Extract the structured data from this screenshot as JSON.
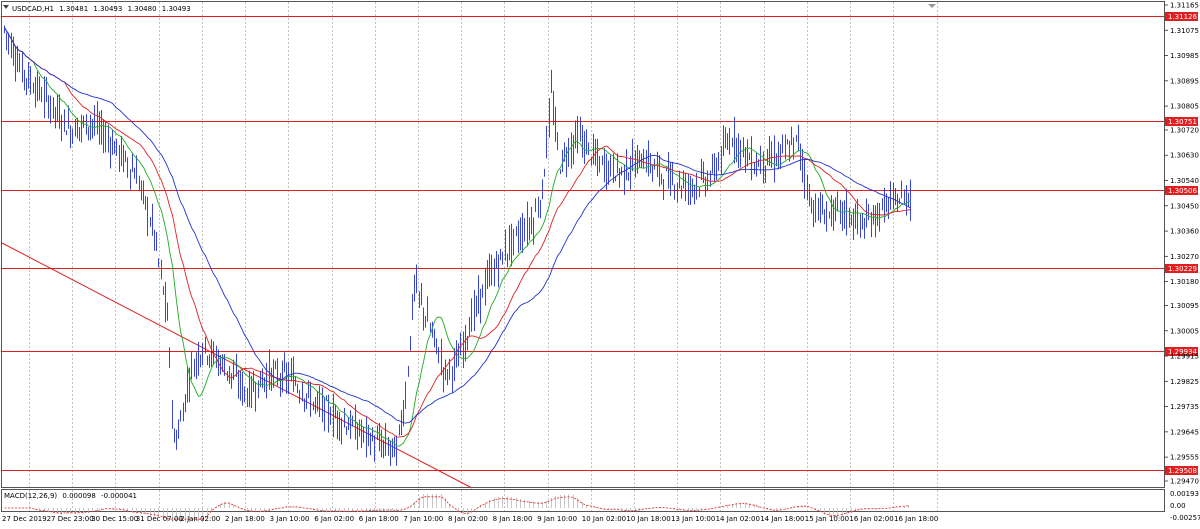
{
  "chart_title": "USDCAD,H1",
  "ohlc": {
    "open": "1.30481",
    "high": "1.30493",
    "low": "1.30480",
    "close": "1.30493"
  },
  "macd_label": "MACD(12,26,9)",
  "macd_values": {
    "main": "0.000098",
    "signal": "-0.000041"
  },
  "colors": {
    "candles": "#2233cc",
    "grid": "#9a9a9a",
    "level": "#e02020",
    "trend": "#e02020",
    "ma_fast": "#22aa22",
    "ma_mid": "#dd2222",
    "ma_slow": "#2233cc",
    "macd_hist": "#b8b8b8",
    "macd_signal": "#e02020"
  },
  "chart_data": {
    "type": "candlestick",
    "symbol": "USDCAD",
    "timeframe": "H1",
    "price_axis_ticks": [
      "1.31165",
      "1.31075",
      "1.30985",
      "1.30895",
      "1.30805",
      "1.30720",
      "1.30630",
      "1.30540",
      "1.30450",
      "1.30360",
      "1.30270",
      "1.30180",
      "1.30095",
      "1.30005",
      "1.29915",
      "1.29825",
      "1.29735",
      "1.29645",
      "1.29555",
      "1.29470"
    ],
    "ylim": [
      1.2946,
      1.3118
    ],
    "time_axis_labels": [
      "27 Dec 2019",
      "27 Dec 23:00",
      "30 Dec 15:00",
      "31 Dec 07:00",
      "2 Jan 02:00",
      "2 Jan 18:00",
      "3 Jan 10:00",
      "6 Jan 02:00",
      "6 Jan 18:00",
      "7 Jan 10:00",
      "8 Jan 02:00",
      "8 Jan 18:00",
      "9 Jan 10:00",
      "10 Jan 02:00",
      "10 Jan 18:00",
      "13 Jan 10:00",
      "14 Jan 02:00",
      "14 Jan 18:00",
      "15 Jan 10:00",
      "16 Jan 02:00",
      "16 Jan 18:00"
    ],
    "horizontal_levels": [
      {
        "label": "1.31126",
        "value": 1.31126
      },
      {
        "label": "1.30751",
        "value": 1.30751
      },
      {
        "label": "1.30506",
        "value": 1.30506
      },
      {
        "label": "1.30229",
        "value": 1.30229
      },
      {
        "label": "1.29934",
        "value": 1.29934
      },
      {
        "label": "1.29508",
        "value": 1.29508
      }
    ],
    "close_path": [
      {
        "t": 0,
        "v": 1.3108
      },
      {
        "t": 0.4,
        "v": 1.3093
      },
      {
        "t": 1.0,
        "v": 1.3082
      },
      {
        "t": 1.5,
        "v": 1.3072
      },
      {
        "t": 2.0,
        "v": 1.3075
      },
      {
        "t": 2.5,
        "v": 1.3066
      },
      {
        "t": 3.0,
        "v": 1.3056
      },
      {
        "t": 3.4,
        "v": 1.3035
      },
      {
        "t": 3.7,
        "v": 1.3005
      },
      {
        "t": 3.85,
        "v": 1.296
      },
      {
        "t": 4.0,
        "v": 1.2968
      },
      {
        "t": 4.2,
        "v": 1.2985
      },
      {
        "t": 4.5,
        "v": 1.2995
      },
      {
        "t": 5.0,
        "v": 1.2988
      },
      {
        "t": 5.5,
        "v": 1.2978
      },
      {
        "t": 6.0,
        "v": 1.2985
      },
      {
        "t": 6.5,
        "v": 1.2984
      },
      {
        "t": 7.0,
        "v": 1.2975
      },
      {
        "t": 7.5,
        "v": 1.297
      },
      {
        "t": 8.0,
        "v": 1.2965
      },
      {
        "t": 8.5,
        "v": 1.296
      },
      {
        "t": 8.9,
        "v": 1.2958
      },
      {
        "t": 9.1,
        "v": 1.2978
      },
      {
        "t": 9.3,
        "v": 1.3017
      },
      {
        "t": 9.5,
        "v": 1.3008
      },
      {
        "t": 9.8,
        "v": 1.2995
      },
      {
        "t": 10.0,
        "v": 1.2985
      },
      {
        "t": 10.3,
        "v": 1.299
      },
      {
        "t": 10.6,
        "v": 1.3005
      },
      {
        "t": 11.0,
        "v": 1.302
      },
      {
        "t": 11.5,
        "v": 1.3032
      },
      {
        "t": 12.0,
        "v": 1.304
      },
      {
        "t": 12.2,
        "v": 1.305
      },
      {
        "t": 12.4,
        "v": 1.3085
      },
      {
        "t": 12.6,
        "v": 1.306
      },
      {
        "t": 13.0,
        "v": 1.307
      },
      {
        "t": 13.5,
        "v": 1.306
      },
      {
        "t": 14.0,
        "v": 1.3057
      },
      {
        "t": 14.5,
        "v": 1.3062
      },
      {
        "t": 15.0,
        "v": 1.3055
      },
      {
        "t": 15.5,
        "v": 1.3052
      },
      {
        "t": 16.0,
        "v": 1.3055
      },
      {
        "t": 16.5,
        "v": 1.307
      },
      {
        "t": 17.0,
        "v": 1.306
      },
      {
        "t": 17.5,
        "v": 1.3062
      },
      {
        "t": 18.0,
        "v": 1.3068
      },
      {
        "t": 18.3,
        "v": 1.3045
      },
      {
        "t": 18.6,
        "v": 1.3042
      },
      {
        "t": 19.0,
        "v": 1.3043
      },
      {
        "t": 19.5,
        "v": 1.3038
      },
      {
        "t": 20.0,
        "v": 1.3045
      },
      {
        "t": 20.6,
        "v": 1.30493
      }
    ]
  }
}
